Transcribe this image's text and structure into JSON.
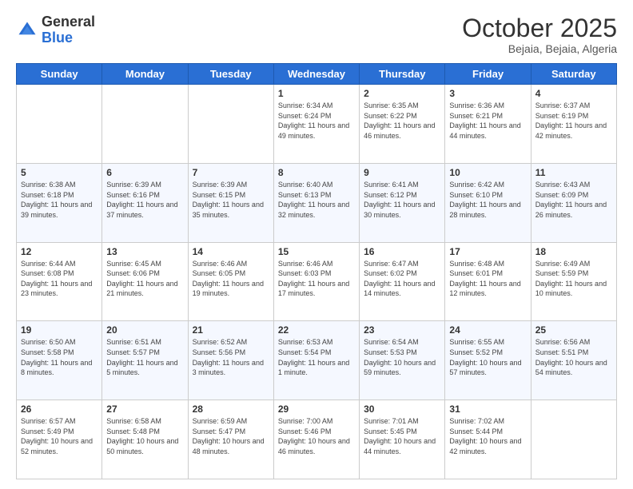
{
  "header": {
    "logo_general": "General",
    "logo_blue": "Blue",
    "month_title": "October 2025",
    "location": "Bejaia, Bejaia, Algeria"
  },
  "days_of_week": [
    "Sunday",
    "Monday",
    "Tuesday",
    "Wednesday",
    "Thursday",
    "Friday",
    "Saturday"
  ],
  "weeks": [
    [
      {
        "day": "",
        "info": ""
      },
      {
        "day": "",
        "info": ""
      },
      {
        "day": "",
        "info": ""
      },
      {
        "day": "1",
        "info": "Sunrise: 6:34 AM\nSunset: 6:24 PM\nDaylight: 11 hours and 49 minutes."
      },
      {
        "day": "2",
        "info": "Sunrise: 6:35 AM\nSunset: 6:22 PM\nDaylight: 11 hours and 46 minutes."
      },
      {
        "day": "3",
        "info": "Sunrise: 6:36 AM\nSunset: 6:21 PM\nDaylight: 11 hours and 44 minutes."
      },
      {
        "day": "4",
        "info": "Sunrise: 6:37 AM\nSunset: 6:19 PM\nDaylight: 11 hours and 42 minutes."
      }
    ],
    [
      {
        "day": "5",
        "info": "Sunrise: 6:38 AM\nSunset: 6:18 PM\nDaylight: 11 hours and 39 minutes."
      },
      {
        "day": "6",
        "info": "Sunrise: 6:39 AM\nSunset: 6:16 PM\nDaylight: 11 hours and 37 minutes."
      },
      {
        "day": "7",
        "info": "Sunrise: 6:39 AM\nSunset: 6:15 PM\nDaylight: 11 hours and 35 minutes."
      },
      {
        "day": "8",
        "info": "Sunrise: 6:40 AM\nSunset: 6:13 PM\nDaylight: 11 hours and 32 minutes."
      },
      {
        "day": "9",
        "info": "Sunrise: 6:41 AM\nSunset: 6:12 PM\nDaylight: 11 hours and 30 minutes."
      },
      {
        "day": "10",
        "info": "Sunrise: 6:42 AM\nSunset: 6:10 PM\nDaylight: 11 hours and 28 minutes."
      },
      {
        "day": "11",
        "info": "Sunrise: 6:43 AM\nSunset: 6:09 PM\nDaylight: 11 hours and 26 minutes."
      }
    ],
    [
      {
        "day": "12",
        "info": "Sunrise: 6:44 AM\nSunset: 6:08 PM\nDaylight: 11 hours and 23 minutes."
      },
      {
        "day": "13",
        "info": "Sunrise: 6:45 AM\nSunset: 6:06 PM\nDaylight: 11 hours and 21 minutes."
      },
      {
        "day": "14",
        "info": "Sunrise: 6:46 AM\nSunset: 6:05 PM\nDaylight: 11 hours and 19 minutes."
      },
      {
        "day": "15",
        "info": "Sunrise: 6:46 AM\nSunset: 6:03 PM\nDaylight: 11 hours and 17 minutes."
      },
      {
        "day": "16",
        "info": "Sunrise: 6:47 AM\nSunset: 6:02 PM\nDaylight: 11 hours and 14 minutes."
      },
      {
        "day": "17",
        "info": "Sunrise: 6:48 AM\nSunset: 6:01 PM\nDaylight: 11 hours and 12 minutes."
      },
      {
        "day": "18",
        "info": "Sunrise: 6:49 AM\nSunset: 5:59 PM\nDaylight: 11 hours and 10 minutes."
      }
    ],
    [
      {
        "day": "19",
        "info": "Sunrise: 6:50 AM\nSunset: 5:58 PM\nDaylight: 11 hours and 8 minutes."
      },
      {
        "day": "20",
        "info": "Sunrise: 6:51 AM\nSunset: 5:57 PM\nDaylight: 11 hours and 5 minutes."
      },
      {
        "day": "21",
        "info": "Sunrise: 6:52 AM\nSunset: 5:56 PM\nDaylight: 11 hours and 3 minutes."
      },
      {
        "day": "22",
        "info": "Sunrise: 6:53 AM\nSunset: 5:54 PM\nDaylight: 11 hours and 1 minute."
      },
      {
        "day": "23",
        "info": "Sunrise: 6:54 AM\nSunset: 5:53 PM\nDaylight: 10 hours and 59 minutes."
      },
      {
        "day": "24",
        "info": "Sunrise: 6:55 AM\nSunset: 5:52 PM\nDaylight: 10 hours and 57 minutes."
      },
      {
        "day": "25",
        "info": "Sunrise: 6:56 AM\nSunset: 5:51 PM\nDaylight: 10 hours and 54 minutes."
      }
    ],
    [
      {
        "day": "26",
        "info": "Sunrise: 6:57 AM\nSunset: 5:49 PM\nDaylight: 10 hours and 52 minutes."
      },
      {
        "day": "27",
        "info": "Sunrise: 6:58 AM\nSunset: 5:48 PM\nDaylight: 10 hours and 50 minutes."
      },
      {
        "day": "28",
        "info": "Sunrise: 6:59 AM\nSunset: 5:47 PM\nDaylight: 10 hours and 48 minutes."
      },
      {
        "day": "29",
        "info": "Sunrise: 7:00 AM\nSunset: 5:46 PM\nDaylight: 10 hours and 46 minutes."
      },
      {
        "day": "30",
        "info": "Sunrise: 7:01 AM\nSunset: 5:45 PM\nDaylight: 10 hours and 44 minutes."
      },
      {
        "day": "31",
        "info": "Sunrise: 7:02 AM\nSunset: 5:44 PM\nDaylight: 10 hours and 42 minutes."
      },
      {
        "day": "",
        "info": ""
      }
    ]
  ]
}
